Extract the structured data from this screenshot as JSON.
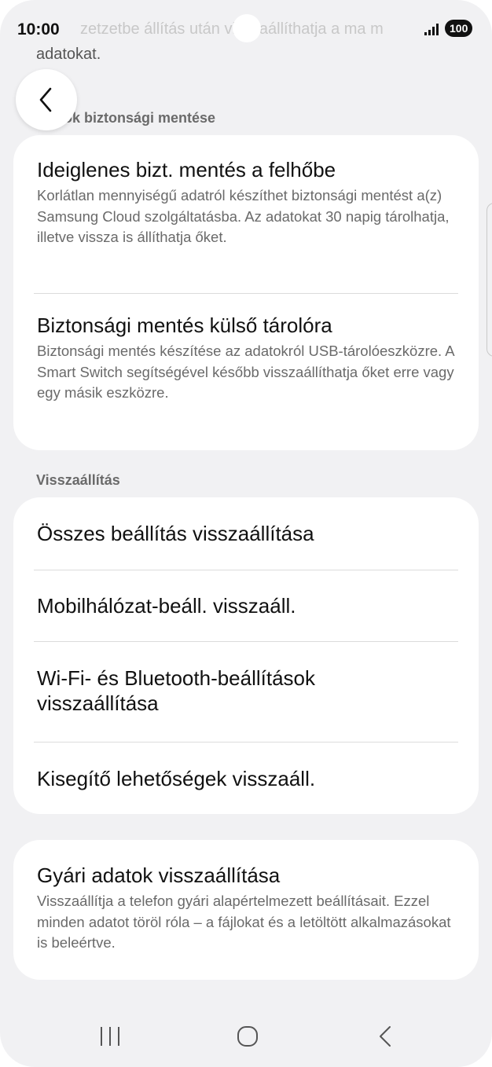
{
  "status_bar": {
    "time": "10:00",
    "background_text": "zetzetbe állítás után visszaállíthatja a ma m",
    "battery": "100",
    "signal_icon": "signal-bars-icon"
  },
  "header": {
    "previous_text": "adatokat.",
    "back_icon": "chevron-left-icon"
  },
  "backup_section": {
    "header": "Adatok biztonsági mentése",
    "header_visible": "tok biztonsági mentése",
    "items": [
      {
        "title": "Ideiglenes bizt. mentés a felhőbe",
        "description": "Korlátlan mennyiségű adatról készíthet biztonsági mentést a(z) Samsung Cloud szolgáltatásba. Az adatokat 30 napig tárolhatja, illetve vissza is állíthatja őket."
      },
      {
        "title": "Biztonsági mentés külső tárolóra",
        "description": "Biztonsági mentés készítése az adatokról USB-tárolóeszközre. A Smart Switch segítségével később visszaállíthatja őket erre vagy egy másik eszközre."
      }
    ]
  },
  "reset_section": {
    "header": "Visszaállítás",
    "items": [
      {
        "title": "Összes beállítás visszaállítása"
      },
      {
        "title": "Mobilhálózat-beáll. visszaáll."
      },
      {
        "title": "Wi-Fi- és Bluetooth-beállítások visszaállítása"
      },
      {
        "title": "Kisegítő lehetőségek visszaáll."
      }
    ]
  },
  "factory_reset": {
    "title": "Gyári adatok visszaállítása",
    "description": "Visszaállítja a telefon gyári alapértelmezett beállításait. Ezzel minden adatot töröl róla – a fájlokat és a letöltött alkalmazásokat is beleértve."
  },
  "navigation": {
    "recents_icon": "recents-icon",
    "home_icon": "home-icon",
    "back_icon": "back-icon"
  },
  "colors": {
    "background": "#f1f1f3",
    "card": "#ffffff",
    "secondary_text": "#6a6a6a"
  }
}
